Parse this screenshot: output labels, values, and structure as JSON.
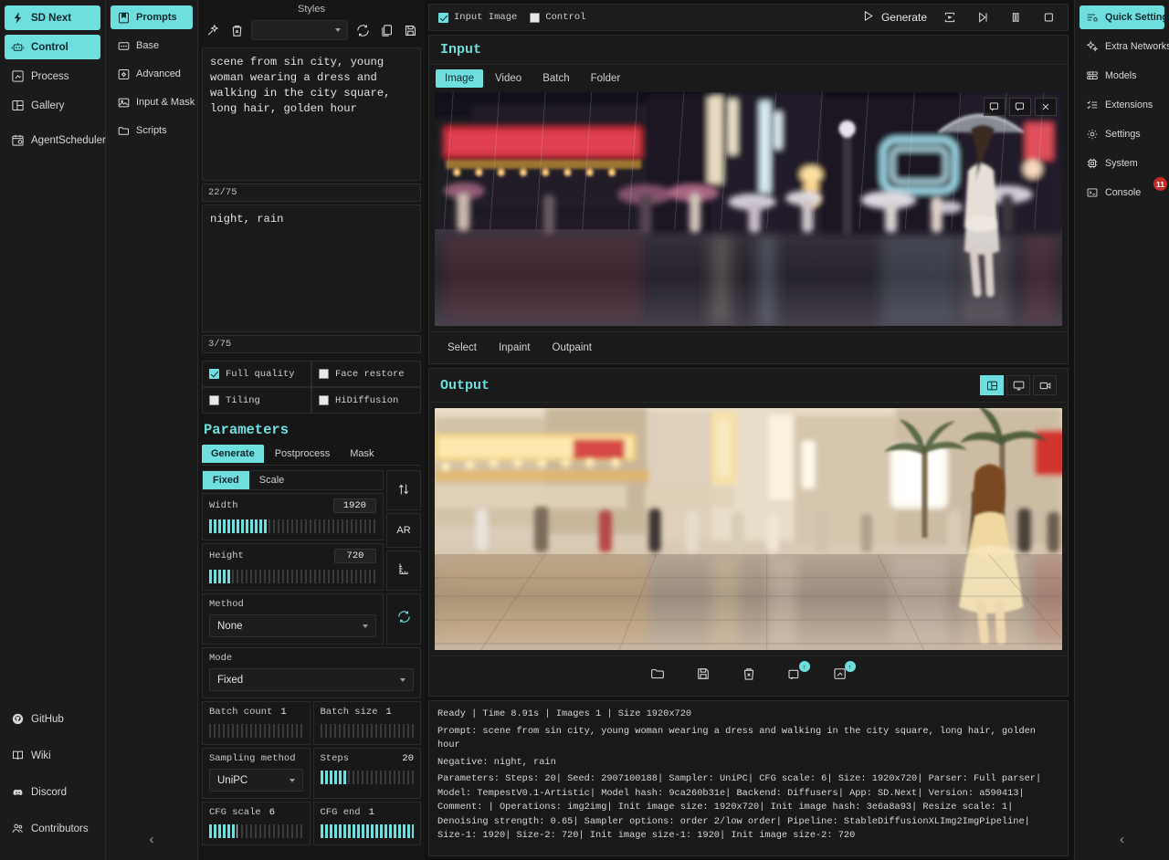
{
  "left_nav": {
    "items": [
      {
        "label": "SD Next",
        "icon": "logo-icon",
        "active": true
      },
      {
        "label": "Control",
        "icon": "robot-icon",
        "active": true
      },
      {
        "label": "Process",
        "icon": "process-icon",
        "active": false
      },
      {
        "label": "Gallery",
        "icon": "gallery-icon",
        "active": false
      },
      {
        "label": "AgentScheduler",
        "icon": "calendar-clock-icon",
        "active": false
      }
    ],
    "bottom_items": [
      {
        "label": "GitHub",
        "icon": "github-icon"
      },
      {
        "label": "Wiki",
        "icon": "book-icon"
      },
      {
        "label": "Discord",
        "icon": "discord-icon"
      },
      {
        "label": "Contributors",
        "icon": "people-icon"
      }
    ]
  },
  "sub_nav": {
    "items": [
      {
        "label": "Prompts",
        "icon": "bookmark-icon",
        "active": true
      },
      {
        "label": "Base",
        "icon": "sliders-icon",
        "active": false
      },
      {
        "label": "Advanced",
        "icon": "gear-box-icon",
        "active": false
      },
      {
        "label": "Input & Mask",
        "icon": "image-icon",
        "active": false
      },
      {
        "label": "Scripts",
        "icon": "folder-icon",
        "active": false
      }
    ],
    "collapse_label": "‹"
  },
  "prompt_panel": {
    "styles_title": "Styles",
    "styles_toolbar": [
      "magic-wand-icon",
      "delete-icon",
      "styles-dropdown",
      "refresh-icon",
      "copy-icon",
      "save-icon"
    ],
    "styles_selected": "",
    "positive_prompt": "scene from sin city, young woman wearing a dress and walking in the city square, long hair, golden hour",
    "positive_counter": "22/75",
    "negative_prompt": "night, rain",
    "negative_counter": "3/75",
    "checkboxes": [
      {
        "label": "Full quality",
        "checked": true
      },
      {
        "label": "Face restore",
        "checked": false
      },
      {
        "label": "Tiling",
        "checked": false
      },
      {
        "label": "HiDiffusion",
        "checked": false
      }
    ]
  },
  "parameters": {
    "title": "Parameters",
    "tabs": [
      {
        "label": "Generate",
        "active": true
      },
      {
        "label": "Postprocess",
        "active": false
      },
      {
        "label": "Mask",
        "active": false
      }
    ],
    "size_modes": [
      {
        "label": "Fixed",
        "active": true
      },
      {
        "label": "Scale",
        "active": false
      }
    ],
    "side_buttons": [
      "swap-icon",
      "AR",
      "ruler-icon"
    ],
    "ar_label": "AR",
    "width": {
      "label": "Width",
      "value": "1920",
      "fill_pct": 35
    },
    "height": {
      "label": "Height",
      "value": "720",
      "fill_pct": 13
    },
    "method": {
      "label": "Method",
      "value": "None"
    },
    "mode": {
      "label": "Mode",
      "value": "Fixed"
    },
    "batch_count": {
      "label": "Batch count",
      "value": "1",
      "fill_pct": 0
    },
    "batch_size": {
      "label": "Batch size",
      "value": "1",
      "fill_pct": 0
    },
    "sampling_method": {
      "label": "Sampling method",
      "value": "UniPC"
    },
    "steps": {
      "label": "Steps",
      "value": "20",
      "fill_pct": 29
    },
    "cfg_scale": {
      "label": "CFG scale",
      "value": "6",
      "fill_pct": 30
    },
    "cfg_end": {
      "label": "CFG end",
      "value": "1",
      "fill_pct": 100
    }
  },
  "topbar": {
    "input_image_label": "Input Image",
    "input_image_checked": true,
    "control_label": "Control",
    "control_checked": false,
    "generate_label": "Generate",
    "icons": [
      "enqueue-icon",
      "skip-icon",
      "pause-icon",
      "stop-icon"
    ]
  },
  "input_section": {
    "title": "Input",
    "tabs": [
      {
        "label": "Image",
        "active": true
      },
      {
        "label": "Video",
        "active": false
      },
      {
        "label": "Batch",
        "active": false
      },
      {
        "label": "Folder",
        "active": false
      }
    ],
    "overlay_icons": [
      "expand-icon",
      "expand-alt-icon",
      "close-icon"
    ],
    "actions": [
      "Select",
      "Inpaint",
      "Outpaint"
    ]
  },
  "output_section": {
    "title": "Output",
    "view_icons": [
      {
        "name": "gallery-view-icon",
        "active": true
      },
      {
        "name": "monitor-view-icon",
        "active": false
      },
      {
        "name": "video-view-icon",
        "active": false
      }
    ],
    "toolbar": [
      {
        "name": "folder-icon",
        "badge": ""
      },
      {
        "name": "save-icon",
        "badge": ""
      },
      {
        "name": "delete-icon",
        "badge": ""
      },
      {
        "name": "send-to-control-icon",
        "badge": "↑"
      },
      {
        "name": "send-to-process-icon",
        "badge": "↑"
      }
    ]
  },
  "log": {
    "status": "Ready | Time 8.91s | Images 1 | Size 1920x720",
    "prompt_line": "Prompt: scene from sin city, young woman wearing a dress and walking in the city square, long hair, golden hour",
    "negative_line": "Negative: night, rain",
    "parameters_line": "Parameters: Steps: 20| Seed: 2907100188| Sampler: UniPC| CFG scale: 6| Size: 1920x720| Parser: Full parser| Model: TempestV0.1-Artistic| Model hash: 9ca260b31e| Backend: Diffusers| App: SD.Next| Version: a590413| Comment: | Operations: img2img| Init image size: 1920x720| Init image hash: 3e6a8a93| Resize scale: 1| Denoising strength: 0.65| Sampler options: order 2/low order| Pipeline: StableDiffusionXLImg2ImgPipeline| Size-1: 1920| Size-2: 720| Init image size-1: 1920| Init image size-2: 720"
  },
  "right_nav": {
    "items": [
      {
        "label": "Quick Settings",
        "icon": "sliders-gear-icon",
        "active": true,
        "badge": ""
      },
      {
        "label": "Extra Networks",
        "icon": "sparkles-icon",
        "active": false,
        "badge": ""
      },
      {
        "label": "Models",
        "icon": "models-icon",
        "active": false,
        "badge": ""
      },
      {
        "label": "Extensions",
        "icon": "checklist-icon",
        "active": false,
        "badge": ""
      },
      {
        "label": "Settings",
        "icon": "gear-icon",
        "active": false,
        "badge": ""
      },
      {
        "label": "System",
        "icon": "cpu-icon",
        "active": false,
        "badge": ""
      },
      {
        "label": "Console",
        "icon": "terminal-icon",
        "active": false,
        "badge": "11"
      }
    ],
    "collapse_label": "‹"
  },
  "colors": {
    "accent": "#6fdede",
    "bg": "#121212",
    "panel": "#1a1a1a",
    "badge_red": "#c92b2b"
  }
}
